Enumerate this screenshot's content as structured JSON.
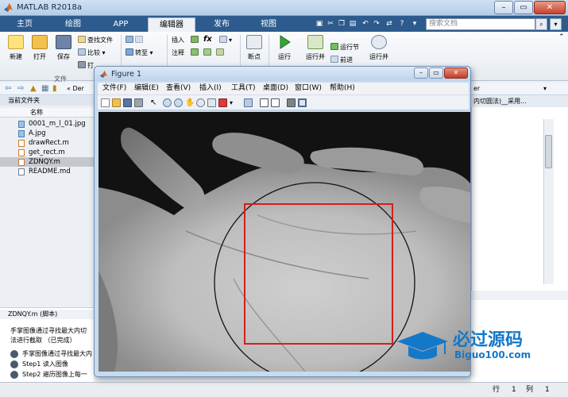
{
  "window": {
    "title": "MATLAB R2018a",
    "minimize": "–",
    "maximize": "▭",
    "close": "✕"
  },
  "tabs": [
    {
      "label": "主页"
    },
    {
      "label": "绘图"
    },
    {
      "label": "APP"
    },
    {
      "label": "编辑器"
    },
    {
      "label": "发布"
    },
    {
      "label": "视图"
    }
  ],
  "search": {
    "placeholder": "搜索文档"
  },
  "ribbon": {
    "new_label": "新建",
    "open_label": "打开",
    "save_label": "保存",
    "find_files": "查找文件",
    "compare": "比较",
    "print": "打",
    "goto": "转至",
    "insert": "插入",
    "comment": "注释",
    "fx": "fx",
    "breakpoint": "断点",
    "run": "运行",
    "run_advance": "运行并",
    "run_section": "运行节",
    "advance": "前进",
    "run_time": "运行并",
    "file_group": "文件"
  },
  "address": {
    "path": "« Der",
    "right_path": "er"
  },
  "current_folder": {
    "header": "当前文件夹",
    "name_col": "名称"
  },
  "files": [
    {
      "name": "0001_m_l_01.jpg",
      "type": "image"
    },
    {
      "name": "A.jpg",
      "type": "image"
    },
    {
      "name": "drawRect.m",
      "type": "mfile"
    },
    {
      "name": "get_rect.m",
      "type": "mfile"
    },
    {
      "name": "ZDNQY.m",
      "type": "mfile",
      "selected": true
    },
    {
      "name": "README.md",
      "type": "doc"
    }
  ],
  "details": {
    "header": "ZDNQY.m  (脚本)",
    "line1": "手掌图像通过寻找最大内切",
    "line2": "法进行截取 （已完成）",
    "item1": "手掌图像通过寻找最大内",
    "item2": "Step1 读入图像",
    "item3": "Step2 遍历图像上每一"
  },
  "editor_tab": "内切圆法)__采用...",
  "figure": {
    "title": "Figure 1",
    "min": "–",
    "max": "▭",
    "close": "✕",
    "menu": [
      "文件(F)",
      "编辑(E)",
      "查看(V)",
      "插入(I)",
      "工具(T)",
      "桌面(D)",
      "窗口(W)",
      "帮助(H)"
    ]
  },
  "status": {
    "row_label": "行",
    "row_value": "1",
    "col_label": "列",
    "col_value": "1"
  },
  "watermark": {
    "main": "必过源码",
    "sub": "Biguo100.com"
  },
  "colors": {
    "accent_tab_bar": "#2d5b8d",
    "rect": "#d71d1d",
    "circle": "#111111",
    "watermark": "#1478c8"
  }
}
